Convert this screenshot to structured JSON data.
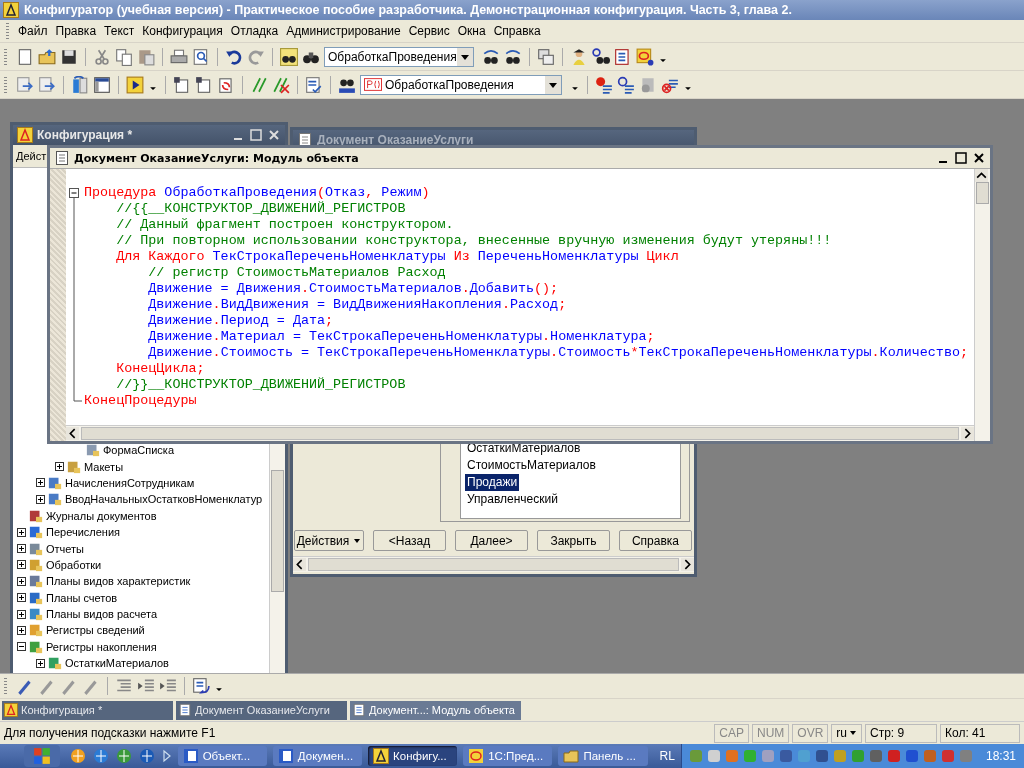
{
  "app": {
    "title": "Конфигуратор (учебная версия) - Практическое пособие разработчика. Демонстрационная конфигурация. Часть 3, глава 2."
  },
  "menu": [
    "Файл",
    "Правка",
    "Текст",
    "Конфигурация",
    "Отладка",
    "Администрирование",
    "Сервис",
    "Окна",
    "Справка"
  ],
  "toolbar_1": {
    "combo_value": "ОбработкаПроведения"
  },
  "toolbar_2": {
    "combo_value": "ОбработкаПроведения"
  },
  "config_window": {
    "title": "Конфигурация *",
    "actions_label": "Дейст",
    "tree": [
      {
        "children": [
          {
            "children": [
              {
                "children": [
                  {
                    "label": "ФормаСписка"
                  }
                ]
              },
              {
                "label": "Макеты",
                "expanded": false
              }
            ]
          },
          {
            "label": "НачисленияСотрудникам",
            "expanded": false
          },
          {
            "label": "ВводНачальныхОстатковНоменклатур",
            "expanded": false
          }
        ]
      },
      {
        "label": "Журналы документов"
      },
      {
        "label": "Перечисления",
        "expanded": false
      },
      {
        "label": "Отчеты",
        "expanded": false
      },
      {
        "label": "Обработки",
        "expanded": false
      },
      {
        "label": "Планы видов характеристик",
        "expanded": false
      },
      {
        "label": "Планы счетов",
        "expanded": false
      },
      {
        "label": "Планы видов расчета",
        "expanded": false
      },
      {
        "label": "Регистры сведений",
        "expanded": false
      },
      {
        "label": "Регистры накопления",
        "expanded": true,
        "children": [
          {
            "label": "ОстаткиМатериалов",
            "expanded": false
          }
        ]
      }
    ]
  },
  "document_window": {
    "title": "Документ ОказаниеУслуги",
    "list": [
      {
        "label": "ОстаткиМатериалов",
        "selected": false
      },
      {
        "label": "СтоимостьМатериалов",
        "selected": false
      },
      {
        "label": "Продажи",
        "selected": true
      },
      {
        "label": "Управленческий",
        "selected": false
      }
    ],
    "buttons": [
      {
        "label": "Действия",
        "kind": "menu"
      },
      {
        "label": "<Назад",
        "kind": "plain"
      },
      {
        "label": "Далее>",
        "kind": "plain"
      },
      {
        "label": "Закрыть",
        "kind": "plain"
      },
      {
        "label": "Справка",
        "kind": "plain"
      }
    ]
  },
  "module_window": {
    "title": "Документ ОказаниеУслуги: Модуль объекта",
    "lines": [
      [
        {
          "kind": "keyword",
          "text": "Процедура"
        },
        {
          "kind": "name",
          "text": " ОбработкаПроведения"
        },
        {
          "kind": "punct",
          "text": "("
        },
        {
          "kind": "name",
          "text": "Отказ"
        },
        {
          "kind": "punct",
          "text": ","
        },
        {
          "kind": "name",
          "text": " Режим"
        },
        {
          "kind": "punct",
          "text": ")"
        }
      ],
      [
        {
          "kind": "comment",
          "text": "    //{{__КОНСТРУКТОР_ДВИЖЕНИЙ_РЕГИСТРОВ"
        }
      ],
      [
        {
          "kind": "comment",
          "text": "    // Данный фрагмент построен конструктором."
        }
      ],
      [
        {
          "kind": "comment",
          "text": "    // При повторном использовании конструктора, внесенные вручную изменения будут утеряны!!!"
        }
      ],
      [
        {
          "kind": "keyword",
          "text": "    Для Каждого"
        },
        {
          "kind": "name",
          "text": " ТекСтрокаПереченьНоменклатуры "
        },
        {
          "kind": "keyword",
          "text": "Из"
        },
        {
          "kind": "name",
          "text": " ПереченьНоменклатуры "
        },
        {
          "kind": "keyword",
          "text": "Цикл"
        }
      ],
      [
        {
          "kind": "comment",
          "text": "        // регистр СтоимостьМатериалов Расход"
        }
      ],
      [
        {
          "kind": "name",
          "text": "        Движение = Движения"
        },
        {
          "kind": "punct",
          "text": "."
        },
        {
          "kind": "name",
          "text": "СтоимостьМатериалов"
        },
        {
          "kind": "punct",
          "text": "."
        },
        {
          "kind": "name",
          "text": "Добавить"
        },
        {
          "kind": "punct",
          "text": "();"
        }
      ],
      [
        {
          "kind": "name",
          "text": "        Движение"
        },
        {
          "kind": "punct",
          "text": "."
        },
        {
          "kind": "name",
          "text": "ВидДвижения = ВидДвиженияНакопления"
        },
        {
          "kind": "punct",
          "text": "."
        },
        {
          "kind": "name",
          "text": "Расход"
        },
        {
          "kind": "punct",
          "text": ";"
        }
      ],
      [
        {
          "kind": "name",
          "text": "        Движение"
        },
        {
          "kind": "punct",
          "text": "."
        },
        {
          "kind": "name",
          "text": "Период = Дата"
        },
        {
          "kind": "punct",
          "text": ";"
        }
      ],
      [
        {
          "kind": "name",
          "text": "        Движение"
        },
        {
          "kind": "punct",
          "text": "."
        },
        {
          "kind": "name",
          "text": "Материал = ТекСтрокаПереченьНоменклатуры"
        },
        {
          "kind": "punct",
          "text": "."
        },
        {
          "kind": "name",
          "text": "Номенклатура"
        },
        {
          "kind": "punct",
          "text": ";"
        }
      ],
      [
        {
          "kind": "name",
          "text": "        Движение"
        },
        {
          "kind": "punct",
          "text": "."
        },
        {
          "kind": "name",
          "text": "Стоимость = ТекСтрокаПереченьНоменклатуры"
        },
        {
          "kind": "punct",
          "text": "."
        },
        {
          "kind": "name",
          "text": "Стоимость"
        },
        {
          "kind": "punct",
          "text": "*"
        },
        {
          "kind": "name",
          "text": "ТекСтрокаПереченьНоменклатуры"
        },
        {
          "kind": "punct",
          "text": "."
        },
        {
          "kind": "name",
          "text": "Количество"
        },
        {
          "kind": "punct",
          "text": ";"
        }
      ],
      [
        {
          "kind": "keyword",
          "text": "    КонецЦикла;"
        }
      ],
      [
        {
          "kind": "comment",
          "text": "    //}}__КОНСТРУКТОР_ДВИЖЕНИЙ_РЕГИСТРОВ"
        }
      ],
      [
        {
          "kind": "keyword",
          "text": "КонецПроцедуры"
        }
      ]
    ]
  },
  "window_tabs": [
    {
      "label": "Конфигурация *",
      "selected": false
    },
    {
      "label": "Документ ОказаниеУслуги",
      "selected": false
    },
    {
      "label": "Документ...: Модуль объекта",
      "selected": true
    }
  ],
  "status_bar": {
    "hint": "Для получения подсказки нажмите F1",
    "indicators": [
      {
        "label": "CAP",
        "on": false
      },
      {
        "label": "NUM",
        "on": false
      },
      {
        "label": "OVR",
        "on": false
      }
    ],
    "language": "ru",
    "line": "Стр: 9",
    "column": "Кол: 41"
  },
  "taskbar": {
    "tasks": [
      {
        "label": "Объект...",
        "selected": false
      },
      {
        "label": "Докумен...",
        "selected": false
      },
      {
        "label": "Конфигу...",
        "selected": true
      },
      {
        "label": "1С:Пред...",
        "selected": false
      },
      {
        "label": "Панель ...",
        "selected": false
      }
    ],
    "language": "RL",
    "clock": "18:31"
  }
}
